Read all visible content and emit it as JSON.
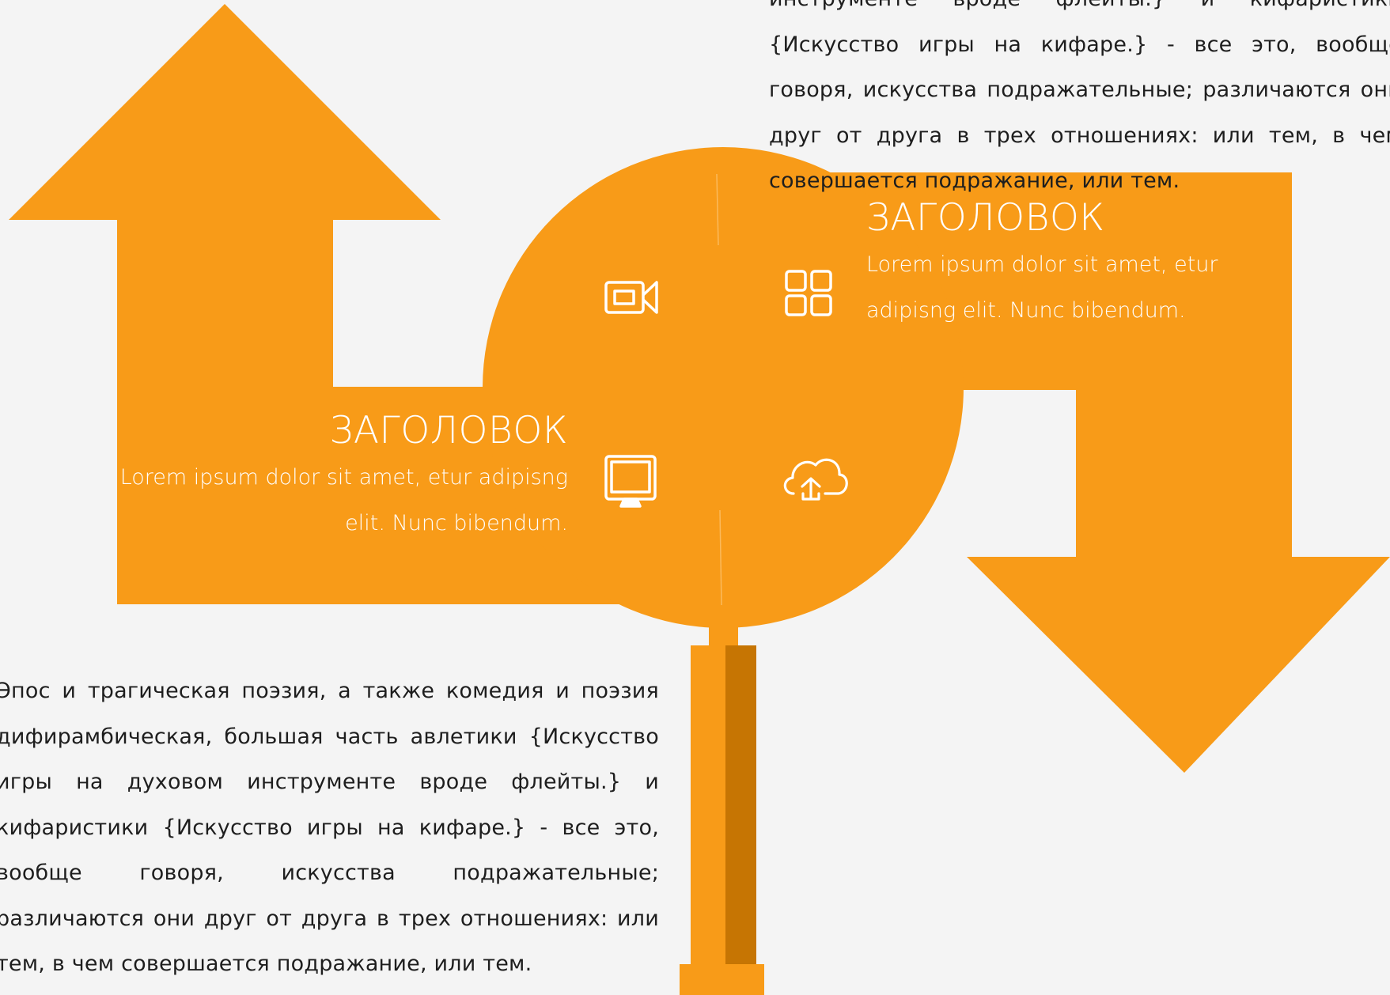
{
  "paragraphs": {
    "top": "инструменте вроде флейты.} и кифаристики {Искусство игры на кифаре.} - все это, вообще говоря, искусства подражательные; различаются они друг от друга в трех отношениях: или тем, в чем совершается подражание, или тем.",
    "bottom": "Эпос и трагическая поэзия, а также комедия и поэзия дифирамбическая, большая часть авлетики {Искусство игры на духовом инструменте вроде флейты.} и кифаристики {Искусство игры на кифаре.} - все это, вообще говоря, искусства подражательные; различаются они друг от друга в трех отношениях: или тем, в чем совершается подражание, или тем."
  },
  "panels": {
    "right": {
      "heading": "ЗАГОЛОВОК",
      "body": "Lorem ipsum dolor sit amet, etur adipisng elit. Nunc bibendum."
    },
    "left": {
      "heading": "ЗАГОЛОВОК",
      "body": "Lorem ipsum dolor sit amet, etur adipisng elit. Nunc bibendum."
    }
  },
  "icons": [
    "video-camera-icon",
    "grid-icon",
    "monitor-icon",
    "cloud-upload-icon"
  ],
  "colors": {
    "background": "#f4f4f4",
    "orange": "#f89b18",
    "orange_dark": "#c67503",
    "text": "#1e1e1e",
    "white": "#ffffff"
  }
}
